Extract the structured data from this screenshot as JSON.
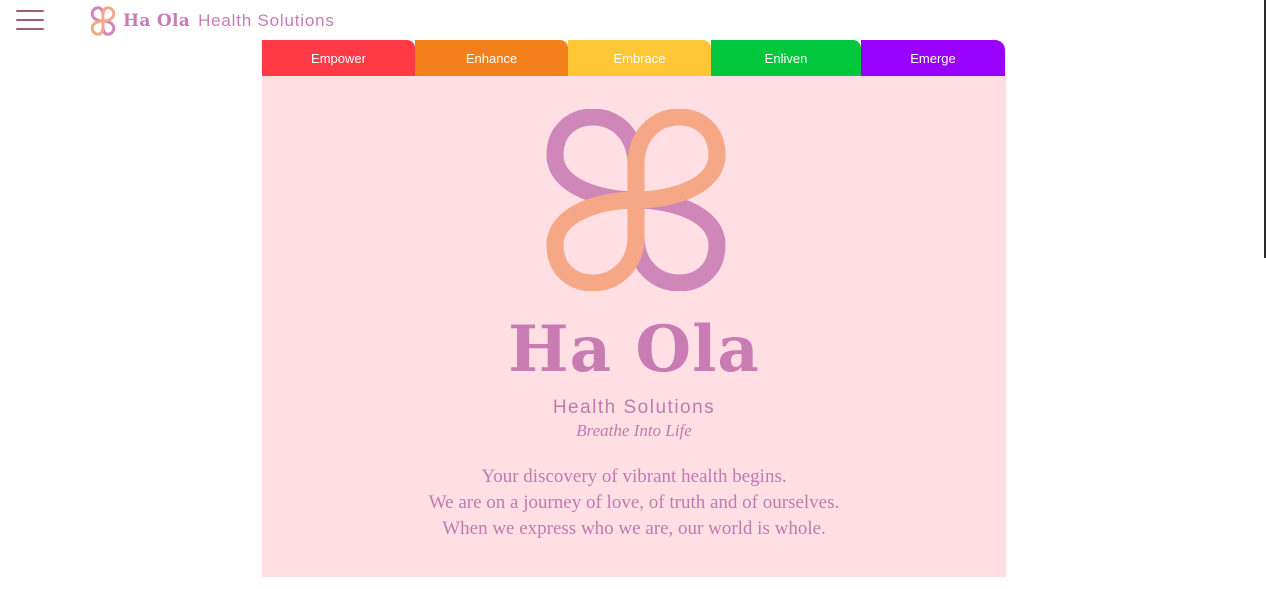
{
  "header": {
    "brand_name": "Ha Ola",
    "brand_sub": "Health Solutions",
    "menu_icon": "hamburger-menu-icon"
  },
  "tabs": [
    {
      "label": "Empower",
      "color": "#ff3a46"
    },
    {
      "label": "Enhance",
      "color": "#f4801c"
    },
    {
      "label": "Embrace",
      "color": "#fdc634"
    },
    {
      "label": "Enliven",
      "color": "#00c73c"
    },
    {
      "label": "Emerge",
      "color": "#9900ff"
    }
  ],
  "hero": {
    "title": "Ha Ola",
    "subtitle": "Health Solutions",
    "tagline": "Breathe Into Life",
    "body_lines": [
      "Your discovery of vibrant health begins.",
      "We are on a journey of love, of truth and of ourselves.",
      "When we express who we are, our world is whole."
    ],
    "background": "#ffdfe3",
    "accent": "#c97bb4",
    "logo_colors": [
      "#c97bb4",
      "#f4a07a"
    ]
  }
}
